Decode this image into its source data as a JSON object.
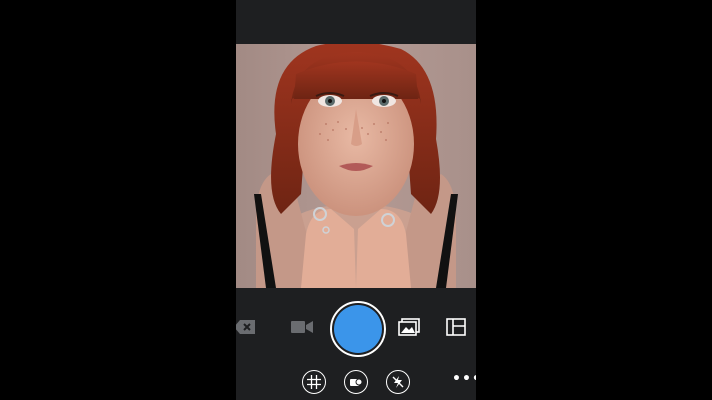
{
  "app": {
    "accent_color": "#3b95ea",
    "background_color": "#1e1f21"
  },
  "preview": {
    "type": "live-camera-preview",
    "description_icon": "portrait-photo"
  },
  "controls": {
    "primary_row": [
      {
        "name": "delete-icon"
      },
      {
        "name": "video-camera-icon"
      },
      {
        "name": "shutter-button",
        "color": "#3b95ea"
      },
      {
        "name": "gallery-icon"
      },
      {
        "name": "layout-icon"
      }
    ],
    "secondary_row": [
      {
        "name": "grid-icon"
      },
      {
        "name": "lens-switch-icon"
      },
      {
        "name": "flash-off-icon"
      }
    ],
    "more_label": "•••"
  }
}
